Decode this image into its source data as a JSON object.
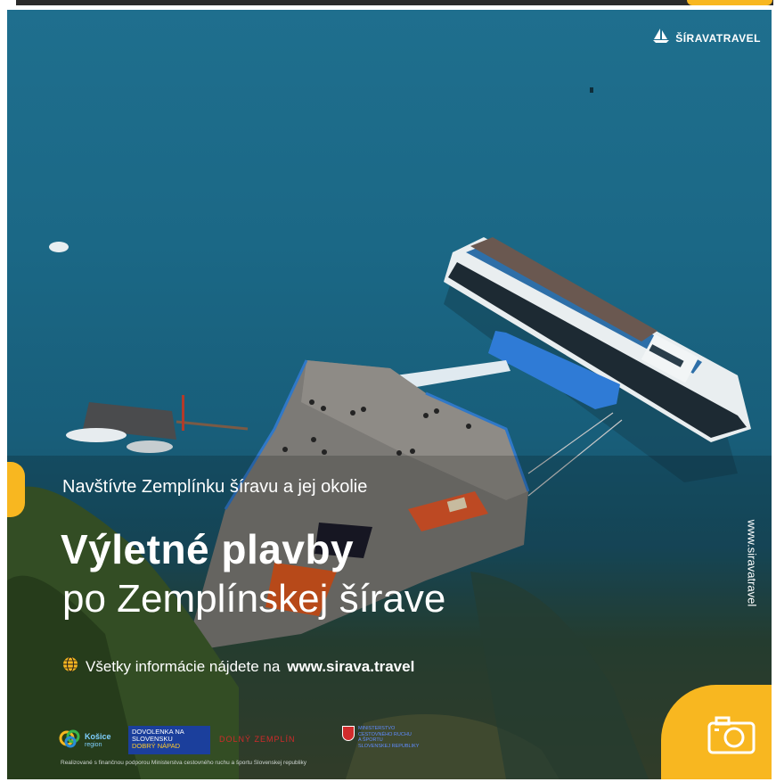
{
  "brand": {
    "name": "ŠÍRAVATRAVEL",
    "icon": "sailboat-icon"
  },
  "side_url": "www.siravatravel",
  "headline": {
    "subtitle": "Navštívte Zemplínku šíravu a jej okolie",
    "title_bold": "Výletné plavby",
    "title_regular": "po Zemplínskej šírave"
  },
  "info": {
    "icon": "globe-icon",
    "text": "Všetky informácie nájdete na ",
    "url": "www.sirava.travel"
  },
  "logos": {
    "kosice_text": "Košice",
    "kosice_sub": "region",
    "dovolenka_line1": "DOVOLENKA NA",
    "dovolenka_line2": "SLOVENSKU",
    "dovolenka_line3": "DOBRÝ NÁPAD",
    "dolny_zemplin": "DOLNÝ ZEMPLÍN",
    "ministry_line1": "MINISTERSTVO",
    "ministry_line2": "CESTOVNÉHO RUCHU",
    "ministry_line3": "A ŠPORTU",
    "ministry_line4": "SLOVENSKEJ REPUBLIKY"
  },
  "funding_note": "Realizované s finančnou podporou Ministerstva cestovného ruchu a športu Slovenskej republiky",
  "camera_icon": "camera-icon",
  "colors": {
    "accent_yellow": "#f8b720",
    "water": "#1b6886",
    "white": "#ffffff"
  }
}
